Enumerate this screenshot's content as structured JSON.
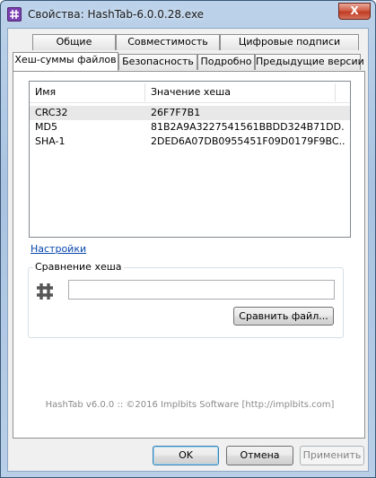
{
  "window": {
    "title": "Свойства: HashTab-6.0.0.28.exe",
    "close_glyph": "X"
  },
  "tabs": {
    "row1": [
      "Общие",
      "Совместимость",
      "Цифровые подписи"
    ],
    "row2": [
      "Хеш-суммы файлов",
      "Безопасность",
      "Подробно",
      "Предыдущие версии"
    ],
    "active": "Хеш-суммы файлов"
  },
  "hash_list": {
    "columns": [
      "Имя",
      "Значение хеша"
    ],
    "rows": [
      {
        "name": "CRC32",
        "value": "26F7F7B1"
      },
      {
        "name": "MD5",
        "value": "81B2A9A3227541561BBDD324B71DD..."
      },
      {
        "name": "SHA-1",
        "value": "2DED6A07DB0955451F09D0179F9BC..."
      }
    ],
    "selected_index": 0
  },
  "settings_link": "Настройки",
  "compare": {
    "group_title": "Сравнение хеша",
    "input_value": "",
    "compare_file_button": "Сравнить файл..."
  },
  "footer": "HashTab v6.0.0 :: ©2016 Implbits Software [http://implbits.com]",
  "buttons": {
    "ok": "OK",
    "cancel": "Отмена",
    "apply": "Применить"
  }
}
